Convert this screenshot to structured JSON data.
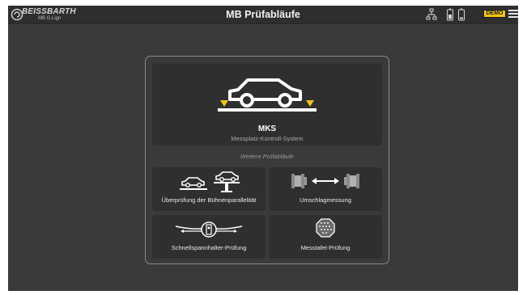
{
  "topbar": {
    "logo_brand": "BEISSBARTH",
    "logo_sub": "MB G.Lign",
    "title": "MB Prüfabläufe",
    "demo_label": "DEMO"
  },
  "main": {
    "mks_card": {
      "title": "MKS",
      "subtitle": "Messplatz-Kontroll-System"
    },
    "section_label": "Weitere Prüfabläufe",
    "cards": [
      {
        "label": "Überprüfung der Bühnenparallelität"
      },
      {
        "label": "Umschlagmessung"
      },
      {
        "label": "Schnellspannhalter-Prüfung"
      },
      {
        "label": "Messtafel-Prüfung"
      }
    ]
  },
  "colors": {
    "accent": "#f3c21a",
    "background": "#3a3a3a",
    "card": "#2f2f2f"
  }
}
